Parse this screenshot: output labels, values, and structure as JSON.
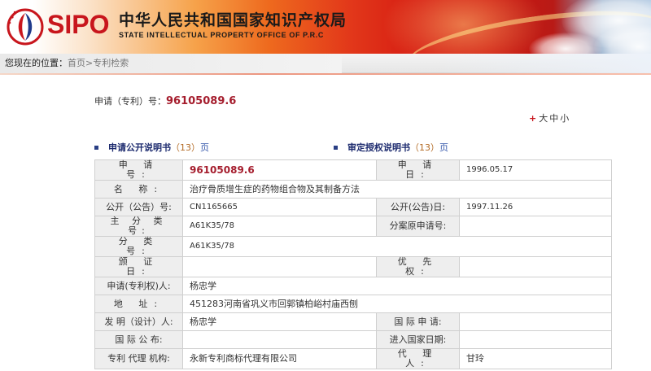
{
  "header": {
    "brand": "SIPO",
    "cn_title": "中华人民共和国国家知识产权局",
    "en_title": "STATE INTELLECTUAL PROPERTY OFFICE OF P.R.C"
  },
  "breadcrumb": {
    "label": "您现在的位置：",
    "home": "首页",
    "separator": ">",
    "current": "专利检索"
  },
  "application": {
    "label": "申请（专利）号：",
    "number": "96105089.6"
  },
  "font_size": {
    "large": "大",
    "medium": "中",
    "small": "小"
  },
  "sections": [
    {
      "title": "申请公开说明书",
      "count": "（13）",
      "unit": "页"
    },
    {
      "title": "审定授权说明书",
      "count": "（13）",
      "unit": "页"
    }
  ],
  "details": {
    "app_no_label": "申 请 号:",
    "app_no_value": "96105089.6",
    "app_date_label": "申 请 日:",
    "app_date_value": "1996.05.17",
    "name_label": "名 称:",
    "name_value": "治疗骨质增生症的药物组合物及其制备方法",
    "pub_no_label": "公开（公告）号:",
    "pub_no_value": "CN1165665",
    "pub_date_label": "公开(公告)日:",
    "pub_date_value": "1997.11.26",
    "main_class_label": "主 分 类 号:",
    "main_class_value": "A61K35/78",
    "div_app_label": "分案原申请号:",
    "div_app_value": "",
    "class_label": "分 类 号:",
    "class_value": "A61K35/78",
    "cert_date_label": "颁 证 日:",
    "cert_date_value": "",
    "priority_label": "优 先 权:",
    "priority_value": "",
    "applicant_label": "申请(专利权)人:",
    "applicant_value": "杨忠学",
    "address_label": "地 址:",
    "address_value": "451283河南省巩义市回郭镇柏峪村庙西刨",
    "inventor_label": "发 明（设计）人:",
    "inventor_value": "杨忠学",
    "intl_app_label": "国 际 申 请:",
    "intl_app_value": "",
    "intl_pub_label": "国 际 公 布:",
    "intl_pub_value": "",
    "national_entry_label": "进入国家日期:",
    "national_entry_value": "",
    "agency_label": "专利 代理 机构:",
    "agency_value": "永新专利商标代理有限公司",
    "agent_label": "代 理 人:",
    "agent_value": "甘玲"
  },
  "colors": {
    "brand_red": "#c8161d",
    "number_red": "#a51d2d",
    "section_navy": "#1c2a6e",
    "count_orange": "#b36a24",
    "link_blue": "#3355aa"
  }
}
